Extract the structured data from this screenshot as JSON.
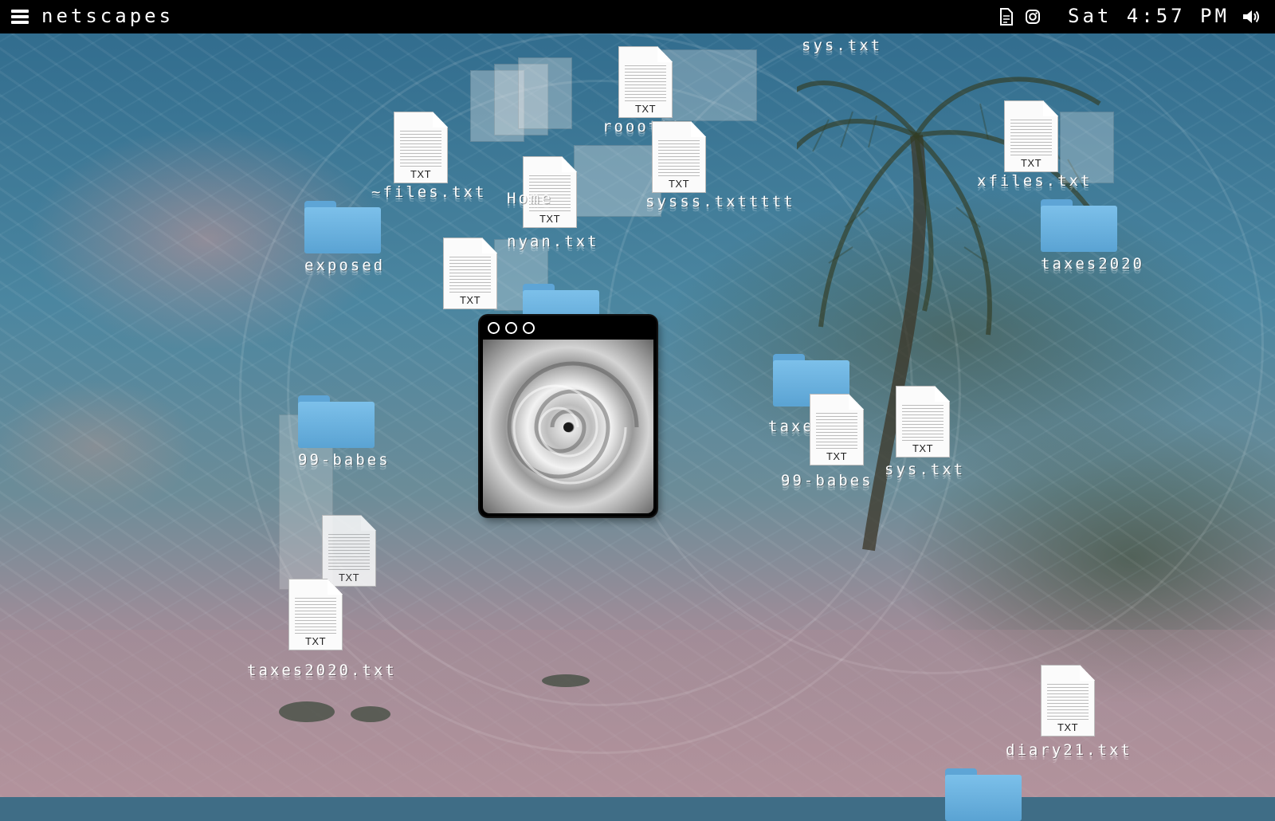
{
  "menubar": {
    "title": "netscapes",
    "clock": "Sat 4:57 PM",
    "icons": [
      "menu-icon",
      "document-icon",
      "instagram-icon",
      "volume-icon"
    ]
  },
  "window": {
    "controls": [
      "close",
      "minimize",
      "maximize"
    ],
    "content": "hurricane-satellite-image"
  },
  "desktop": {
    "doc_ext": "TXT",
    "items": [
      {
        "type": "file",
        "label": "~files.txt"
      },
      {
        "type": "file",
        "label": "rooottt"
      },
      {
        "type": "file",
        "label": "Home"
      },
      {
        "type": "file",
        "label": "sysss.txttttt"
      },
      {
        "type": "file",
        "label": "nyan.txt"
      },
      {
        "type": "file",
        "label": "sys.txt"
      },
      {
        "type": "folder",
        "label": "exposed"
      },
      {
        "type": "folder",
        "label": "99-babes"
      },
      {
        "type": "file",
        "label": "xfiles.txt"
      },
      {
        "type": "folder",
        "label": "taxes2020"
      },
      {
        "type": "folder",
        "label": "taxe"
      },
      {
        "type": "file",
        "label": "99-babes"
      },
      {
        "type": "file",
        "label": "sys.txt"
      },
      {
        "type": "file",
        "label": "taxes2020.txt"
      },
      {
        "type": "file",
        "label": "diary21.txt"
      },
      {
        "type": "folder",
        "label": ""
      }
    ]
  },
  "colors": {
    "menubar": "#000000",
    "folder": "#6db3e2",
    "doc": "#fbfbfb"
  }
}
